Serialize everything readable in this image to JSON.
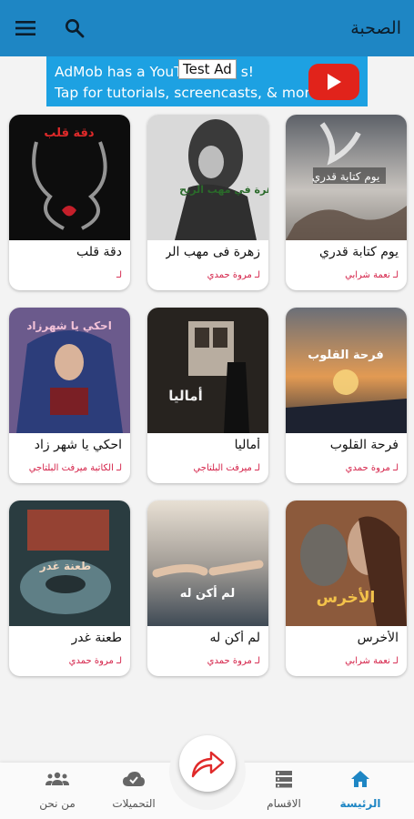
{
  "appbar": {
    "title": "الصحبة"
  },
  "ad": {
    "line1": "AdMob has a YouT",
    "line1_tail": "s!",
    "badge": "Test Ad",
    "line2": "Tap for tutorials, screencasts, & more."
  },
  "books": [
    {
      "title": "يوم كتابة قدري",
      "author": "لـ نعمة شرابي",
      "cover_text": "يوم كتابة قدري"
    },
    {
      "title": "زهرة فى مهب الر",
      "author": "لـ مروة حمدي",
      "cover_text": "زهرة في مهب الريح"
    },
    {
      "title": "دقة قلب",
      "author": "لـ",
      "cover_text": "دقة قلب"
    },
    {
      "title": "فرحة القلوب",
      "author": "لـ مروة حمدي",
      "cover_text": "فرحة القلوب"
    },
    {
      "title": "أماليا",
      "author": "لـ ميرفت البلتاجي",
      "cover_text": "أماليا"
    },
    {
      "title": "احكي يا شهر زاد",
      "author": "لـ الكاتبة ميرفت البلتاجي",
      "cover_text": "احكي يا شهرزاد"
    },
    {
      "title": "الأخرس",
      "author": "لـ نعمة شرابي",
      "cover_text": "الأخرس"
    },
    {
      "title": "لم أكن له",
      "author": "لـ مروة حمدي",
      "cover_text": "لم أكن له"
    },
    {
      "title": "طعنة غدر",
      "author": "لـ مروة حمدي",
      "cover_text": "طعنة غدر"
    }
  ],
  "nav": {
    "home": "الرئيسة",
    "sections": "الاقسام",
    "downloads": "التحميلات",
    "about": "من نحن"
  },
  "colors": {
    "primary": "#1e86c4",
    "author": "#d42047",
    "ad": "#1da1e2"
  }
}
